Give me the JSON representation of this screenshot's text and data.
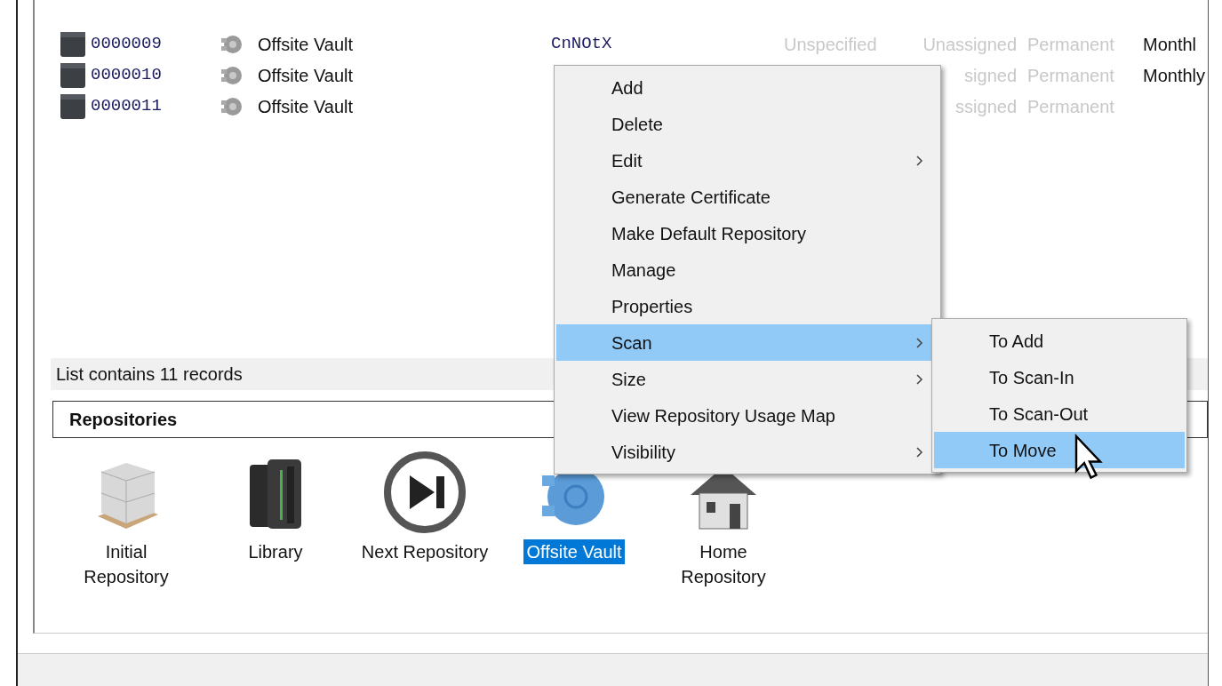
{
  "records": {
    "rows": [
      {
        "cells": [
          {
            "text": "0000009",
            "dimmed": false
          },
          {
            "text": "Offsite Vault",
            "dimmed": false
          },
          {
            "text": "CnNOtX",
            "dimmed": false
          },
          {
            "text": "Unspecified",
            "dimmed": true
          },
          {
            "text": "Unassigned",
            "dimmed": true
          },
          {
            "text": "Permanent",
            "dimmed": true
          },
          {
            "text": "Monthl",
            "dimmed": false
          }
        ]
      },
      {
        "cells": [
          {
            "text": "0000010",
            "dimmed": false
          },
          {
            "text": "Offsite Vault",
            "dimmed": false
          },
          null,
          null,
          {
            "text": "signed",
            "dimmed": true
          },
          {
            "text": "Permanent",
            "dimmed": true
          },
          {
            "text": "Monthly",
            "dimmed": false
          }
        ]
      },
      {
        "cells": [
          {
            "text": "0000011",
            "dimmed": false
          },
          {
            "text": "Offsite Vault",
            "dimmed": false
          },
          null,
          null,
          {
            "text": "ssigned",
            "dimmed": true
          },
          {
            "text": "Permanent",
            "dimmed": true
          },
          null
        ]
      }
    ]
  },
  "status_bar": "List contains 11 records",
  "repositories": {
    "title": "Repositories",
    "items": [
      {
        "label": "Initial\nRepository",
        "kind": "boxes",
        "selected": false
      },
      {
        "label": "Library",
        "kind": "library",
        "selected": false
      },
      {
        "label": "Next Repository",
        "kind": "next",
        "selected": false
      },
      {
        "label": "Offsite Vault",
        "kind": "vault",
        "selected": true
      },
      {
        "label": "Home\nRepository",
        "kind": "home",
        "selected": false
      }
    ]
  },
  "context_menu": {
    "items": [
      {
        "label": "Add",
        "submenu": false,
        "selected": false
      },
      {
        "label": "Delete",
        "submenu": false,
        "selected": false
      },
      {
        "label": "Edit",
        "submenu": true,
        "selected": false
      },
      {
        "label": "Generate Certificate",
        "submenu": false,
        "selected": false
      },
      {
        "label": "Make Default Repository",
        "submenu": false,
        "selected": false
      },
      {
        "label": "Manage",
        "submenu": false,
        "selected": false
      },
      {
        "label": "Properties",
        "submenu": false,
        "selected": false
      },
      {
        "label": "Scan",
        "submenu": true,
        "selected": true
      },
      {
        "label": "Size",
        "submenu": true,
        "selected": false
      },
      {
        "label": "View Repository Usage Map",
        "submenu": false,
        "selected": false
      },
      {
        "label": "Visibility",
        "submenu": true,
        "selected": false
      }
    ],
    "submenu": {
      "items": [
        {
          "label": "To Add",
          "selected": false
        },
        {
          "label": "To Scan-In",
          "selected": false
        },
        {
          "label": "To Scan-Out",
          "selected": false
        },
        {
          "label": "To Move",
          "selected": true
        }
      ]
    }
  }
}
